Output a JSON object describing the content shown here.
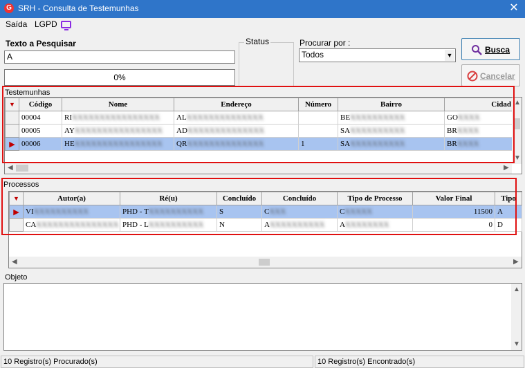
{
  "window": {
    "title": "SRH - Consulta de Testemunhas",
    "logo_letter": "G"
  },
  "menu": {
    "items": [
      "Saída",
      "LGPD"
    ]
  },
  "search": {
    "label": "Texto a Pesquisar",
    "value": "A",
    "progress_text": "0%",
    "progress": 0
  },
  "status_group": {
    "label": "Status"
  },
  "procurar": {
    "label": "Procurar por :",
    "selected": "Todos"
  },
  "buttons": {
    "busca": "Busca",
    "cancelar": "Cancelar"
  },
  "testemunhas": {
    "label": "Testemunhas",
    "columns": [
      "Código",
      "Nome",
      "Endereço",
      "Número",
      "Bairro",
      "Cidad"
    ],
    "rows": [
      {
        "codigo": "00004",
        "nome": "RI",
        "endereco": "AL",
        "numero": "",
        "bairro": "BE",
        "cidade": "GO",
        "selected": false
      },
      {
        "codigo": "00005",
        "nome": "AY",
        "endereco": "AD",
        "numero": "",
        "bairro": "SA",
        "cidade": "BR",
        "selected": false
      },
      {
        "codigo": "00006",
        "nome": "HE",
        "endereco": "QR",
        "numero": "1",
        "bairro": "SA",
        "cidade": "BR",
        "selected": true
      }
    ]
  },
  "processos": {
    "label": "Processos",
    "columns": [
      "Autor(a)",
      "Ré(u)",
      "Concluído",
      "Concluído",
      "Tipo de Processo",
      "Valor Final",
      "Tipo"
    ],
    "rows": [
      {
        "autor": "VI",
        "reu": "PHD - T",
        "concluido1": "S",
        "concluido2": "C",
        "tipo_processo": "C",
        "valor": "11500",
        "tipo": "A",
        "selected": true
      },
      {
        "autor": "CA",
        "reu": "PHD - L",
        "concluido1": "N",
        "concluido2": "A",
        "tipo_processo": "A",
        "valor": "0",
        "tipo": "D",
        "selected": false
      }
    ]
  },
  "objeto": {
    "label": "Objeto"
  },
  "statusbar": {
    "left": "10 Registro(s) Procurado(s)",
    "right": "10 Registro(s) Encontrado(s)"
  },
  "colors": {
    "titlebar": "#2f75c9",
    "selection": "#a8c4f0",
    "highlight_frame": "#e01010",
    "indicator": "#c00000"
  }
}
